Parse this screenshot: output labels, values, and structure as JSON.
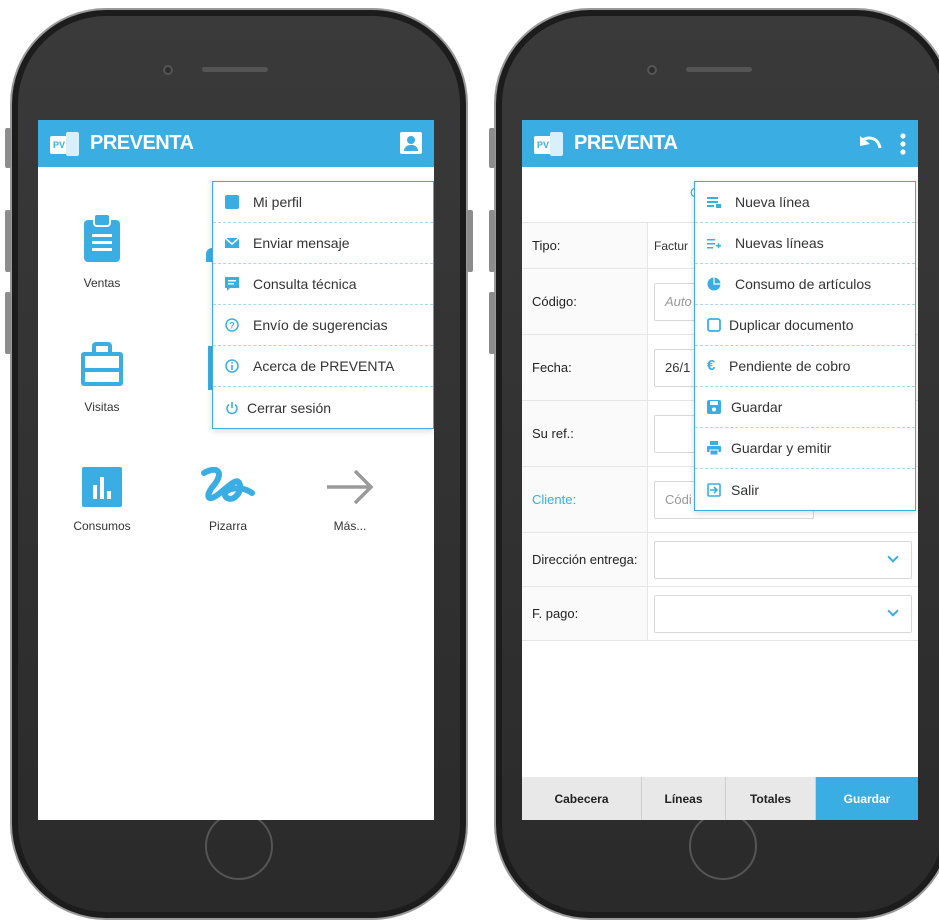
{
  "left": {
    "brand": "PREVENTA",
    "tiles": [
      {
        "label": "Ventas"
      },
      {
        "label": "Visitas"
      },
      {
        "label": "Consumos"
      },
      {
        "label": "Pizarra"
      },
      {
        "label": "Más..."
      }
    ],
    "menu": [
      {
        "label": "Mi perfil",
        "icon": "user-card-icon"
      },
      {
        "label": "Enviar mensaje",
        "icon": "envelope-icon"
      },
      {
        "label": "Consulta técnica",
        "icon": "chat-icon"
      },
      {
        "label": "Envío de sugerencias",
        "icon": "help-circle-icon"
      },
      {
        "label": "Acerca de PREVENTA",
        "icon": "info-icon"
      },
      {
        "label": "Cerrar sesión",
        "icon": "power-icon"
      }
    ]
  },
  "right": {
    "brand": "PREVENTA",
    "tab_fragment": "C",
    "fields": [
      {
        "label": "Tipo:",
        "value": "Factur"
      },
      {
        "label": "Código:",
        "value": "Auto"
      },
      {
        "label": "Fecha:",
        "value": "26/1"
      },
      {
        "label": "Su ref.:",
        "value": ""
      },
      {
        "label": "Cliente:",
        "value": "Códi"
      },
      {
        "label": "Dirección entrega:",
        "value": ""
      },
      {
        "label": "F. pago:",
        "value": ""
      }
    ],
    "menu": [
      {
        "label": "Nueva línea",
        "icon": "list-add-icon"
      },
      {
        "label": "Nuevas líneas",
        "icon": "list-plus-icon"
      },
      {
        "label": "Consumo de artículos",
        "icon": "pie-chart-icon"
      },
      {
        "label": "Duplicar documento",
        "icon": "copy-icon"
      },
      {
        "label": "Pendiente de cobro",
        "icon": "euro-icon"
      },
      {
        "label": "Guardar",
        "icon": "save-icon"
      },
      {
        "label": "Guardar y emitir",
        "icon": "print-icon"
      },
      {
        "label": "Salir",
        "icon": "exit-icon"
      }
    ],
    "tabs": [
      "Cabecera",
      "Líneas",
      "Totales",
      "Guardar"
    ]
  },
  "colors": {
    "accent": "#3aaee3",
    "dark_phone": "#2e2e2e"
  }
}
